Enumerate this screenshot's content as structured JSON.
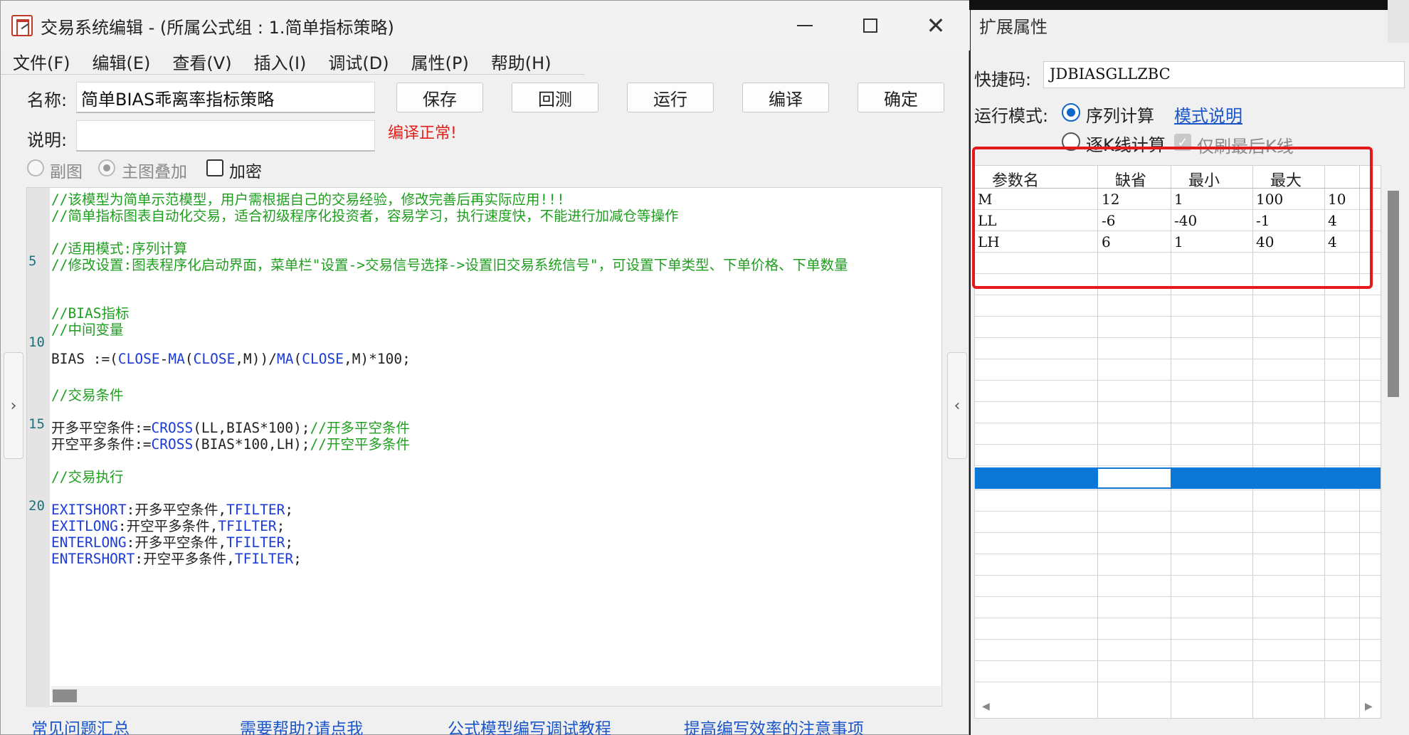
{
  "window": {
    "title": "交易系统编辑 - (所属公式组 : 1.简单指标策略)",
    "controls": {
      "close": "✕"
    }
  },
  "menu": [
    "文件(F)",
    "编辑(E)",
    "查看(V)",
    "插入(I)",
    "调试(D)",
    "属性(P)",
    "帮助(H)"
  ],
  "form": {
    "name_label": "名称:",
    "name_value": "简单BIAS乖离率指标策略",
    "desc_label": "说明:",
    "desc_value": "",
    "compile_status": "编译正常!",
    "radio_sub": "副图",
    "radio_main": "主图叠加",
    "checkbox_encrypt": "加密"
  },
  "buttons": {
    "save": "保存",
    "backtest": "回测",
    "run": "运行",
    "compile": "编译",
    "ok": "确定"
  },
  "editor": {
    "line_numbers": [
      "5",
      "10",
      "15",
      "20"
    ],
    "lines": [
      {
        "t": "//该模型为简单示范模型，用户需根据自己的交易经验，修改完善后再实际应用!!!"
      },
      {
        "t": "//简单指标图表自动化交易，适合初级程序化投资者，容易学习，执行速度快，不能进行加减仓等操作"
      },
      {
        "t": "//适用模式:序列计算"
      },
      {
        "t": "//修改设置:图表程序化启动界面，菜单栏\"设置->交易信号选择->设置旧交易系统信号\"，可设置下单类型、下单价格、下单数量"
      },
      {
        "t": "//BIAS指标"
      },
      {
        "t": "//中间变量"
      },
      {
        "a": "BIAS :=(",
        "b": "CLOSE",
        "c": "-",
        "d": "MA",
        "e": "(",
        "f": "CLOSE",
        "g": ",M))/",
        "h": "MA",
        "i": "(",
        "j": "CLOSE",
        "k": ",M)*100;"
      },
      {
        "t": "//交易条件"
      },
      {
        "a": "开多平空条件:=",
        "b": "CROSS",
        "c": "(LL,BIAS*100);",
        "d": "//开多平空条件"
      },
      {
        "a": "开空平多条件:=",
        "b": "CROSS",
        "c": "(BIAS*100,LH);",
        "d": "//开空平多条件"
      },
      {
        "t": "//交易执行"
      },
      {
        "a": "EXITSHORT",
        "b": ":开多平空条件,",
        "c": "TFILTER",
        "d": ";"
      },
      {
        "a": "EXITLONG",
        "b": ":开空平多条件,",
        "c": "TFILTER",
        "d": ";"
      },
      {
        "a": "ENTERLONG",
        "b": ":开多平空条件,",
        "c": "TFILTER",
        "d": ";"
      },
      {
        "a": "ENTERSHORT",
        "b": ":开空平多条件,",
        "c": "TFILTER",
        "d": ";"
      }
    ]
  },
  "footer_links": [
    "常见问题汇总",
    "需要帮助?请点我",
    "公式模型编写调试教程",
    "提高编写效率的注意事项"
  ],
  "side_tabs": {
    "left": "›",
    "right": "‹"
  },
  "panel": {
    "title": "扩展属性",
    "shortcut_label": "快捷码:",
    "shortcut_value": "JDBIASGLLZBC",
    "run_mode_label": "运行模式:",
    "mode_series": "序列计算",
    "mode_help_link": "模式说明",
    "mode_bar": "逐K线计算",
    "last_bar_only": "仅刷最后K线"
  },
  "params_table": {
    "headers": [
      "参数名",
      "缺省",
      "最小",
      "最大"
    ],
    "rows": [
      [
        "M",
        "12",
        "1",
        "100",
        "10"
      ],
      [
        "LL",
        "-6",
        "-40",
        "-1",
        "4"
      ],
      [
        "LH",
        "6",
        "1",
        "40",
        "4"
      ]
    ]
  },
  "colors": {
    "accent_blue": "#0b78d7",
    "highlight_red": "#e5181b",
    "comment_green": "#1f9e1f",
    "keyword_blue": "#1d3bd6"
  }
}
